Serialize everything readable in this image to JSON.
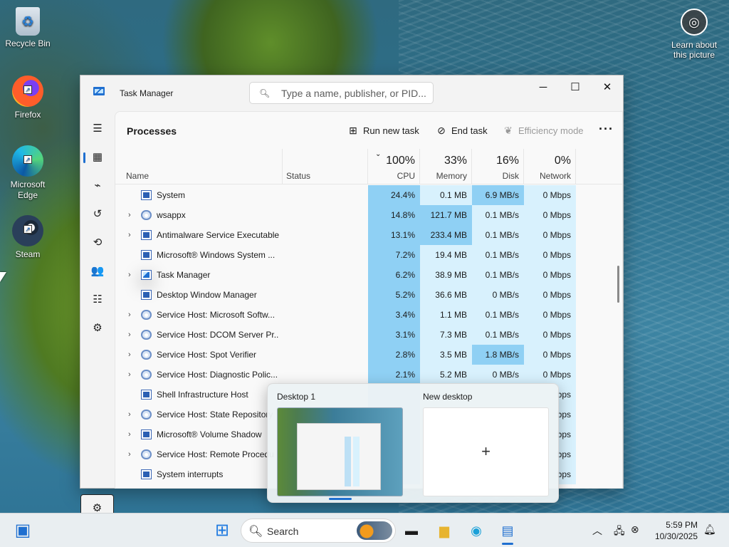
{
  "desktop": {
    "icons": [
      {
        "label": "Recycle Bin",
        "icon": "recycle-bin-icon"
      },
      {
        "label": "Firefox",
        "icon": "firefox-icon"
      },
      {
        "label": "Microsoft Edge",
        "icon": "edge-icon"
      },
      {
        "label": "Steam",
        "icon": "steam-icon"
      }
    ],
    "learn_about": "Learn about this picture"
  },
  "window": {
    "title": "Task Manager",
    "search_placeholder": "Type a name, publisher, or PID...",
    "minimize": "─",
    "maximize": "☐",
    "close": "✕"
  },
  "sidebar": {
    "items": [
      {
        "icon": "hamburger-menu-icon",
        "glyph": "☰"
      },
      {
        "icon": "processes-icon",
        "glyph": "▦"
      },
      {
        "icon": "performance-icon",
        "glyph": "⌁"
      },
      {
        "icon": "app-history-icon",
        "glyph": "↺"
      },
      {
        "icon": "startup-apps-icon",
        "glyph": "⟲"
      },
      {
        "icon": "users-icon",
        "glyph": "👥"
      },
      {
        "icon": "details-icon",
        "glyph": "☷"
      },
      {
        "icon": "services-icon",
        "glyph": "⚙"
      }
    ],
    "settings_glyph": "⚙"
  },
  "toolbar": {
    "page_title": "Processes",
    "run_new_task": "Run new task",
    "end_task": "End task",
    "efficiency_mode": "Efficiency mode",
    "more": "···"
  },
  "columns": {
    "name": "Name",
    "status": "Status",
    "cpu": {
      "pct": "100%",
      "label": "CPU"
    },
    "memory": {
      "pct": "33%",
      "label": "Memory"
    },
    "disk": {
      "pct": "16%",
      "label": "Disk"
    },
    "network": {
      "pct": "0%",
      "label": "Network"
    }
  },
  "processes": [
    {
      "name": "System",
      "expand": false,
      "icon": "window",
      "cpu": "24.4%",
      "memory": "0.1 MB",
      "disk": "6.9 MB/s",
      "network": "0 Mbps"
    },
    {
      "name": "wsappx",
      "expand": true,
      "icon": "gear",
      "cpu": "14.8%",
      "memory": "121.7 MB",
      "disk": "0.1 MB/s",
      "network": "0 Mbps"
    },
    {
      "name": "Antimalware Service Executable",
      "expand": true,
      "icon": "window",
      "cpu": "13.1%",
      "memory": "233.4 MB",
      "disk": "0.1 MB/s",
      "network": "0 Mbps"
    },
    {
      "name": "Microsoft® Windows System ...",
      "expand": false,
      "icon": "window",
      "cpu": "7.2%",
      "memory": "19.4 MB",
      "disk": "0.1 MB/s",
      "network": "0 Mbps"
    },
    {
      "name": "Task Manager",
      "expand": true,
      "icon": "tm",
      "cpu": "6.2%",
      "memory": "38.9 MB",
      "disk": "0.1 MB/s",
      "network": "0 Mbps"
    },
    {
      "name": "Desktop Window Manager",
      "expand": false,
      "icon": "window",
      "cpu": "5.2%",
      "memory": "36.6 MB",
      "disk": "0 MB/s",
      "network": "0 Mbps"
    },
    {
      "name": "Service Host: Microsoft Softw...",
      "expand": true,
      "icon": "gear",
      "cpu": "3.4%",
      "memory": "1.1 MB",
      "disk": "0.1 MB/s",
      "network": "0 Mbps"
    },
    {
      "name": "Service Host: DCOM Server Pr...",
      "expand": true,
      "icon": "gear",
      "cpu": "3.1%",
      "memory": "7.3 MB",
      "disk": "0.1 MB/s",
      "network": "0 Mbps"
    },
    {
      "name": "Service Host: Spot Verifier",
      "expand": true,
      "icon": "gear",
      "cpu": "2.8%",
      "memory": "3.5 MB",
      "disk": "1.8 MB/s",
      "network": "0 Mbps"
    },
    {
      "name": "Service Host: Diagnostic Polic...",
      "expand": true,
      "icon": "gear",
      "cpu": "2.1%",
      "memory": "5.2 MB",
      "disk": "0 MB/s",
      "network": "0 Mbps"
    },
    {
      "name": "Shell Infrastructure Host",
      "expand": false,
      "icon": "window",
      "cpu": "",
      "memory": "",
      "disk": "",
      "network": "bps"
    },
    {
      "name": "Service Host: State Repository",
      "expand": true,
      "icon": "gear",
      "cpu": "",
      "memory": "",
      "disk": "",
      "network": "bps"
    },
    {
      "name": "Microsoft® Volume Shadow",
      "expand": true,
      "icon": "window",
      "cpu": "",
      "memory": "",
      "disk": "",
      "network": "bps"
    },
    {
      "name": "Service Host: Remote Procedu",
      "expand": true,
      "icon": "gear",
      "cpu": "",
      "memory": "",
      "disk": "",
      "network": "bps"
    },
    {
      "name": "System interrupts",
      "expand": false,
      "icon": "window",
      "cpu": "",
      "memory": "",
      "disk": "",
      "network": "bps"
    }
  ],
  "virtual_desktops": {
    "desktop1": "Desktop 1",
    "new_desktop": "New desktop",
    "plus": "+"
  },
  "taskbar": {
    "search_label": "Search",
    "time": "5:59 PM",
    "date": "10/30/2025"
  },
  "colors": {
    "accent": "#1f6fd0",
    "cpu_heat_strong": "#8fd0f4",
    "heat_light": "#bde6fb",
    "heat_pale": "#d8f1fd"
  }
}
